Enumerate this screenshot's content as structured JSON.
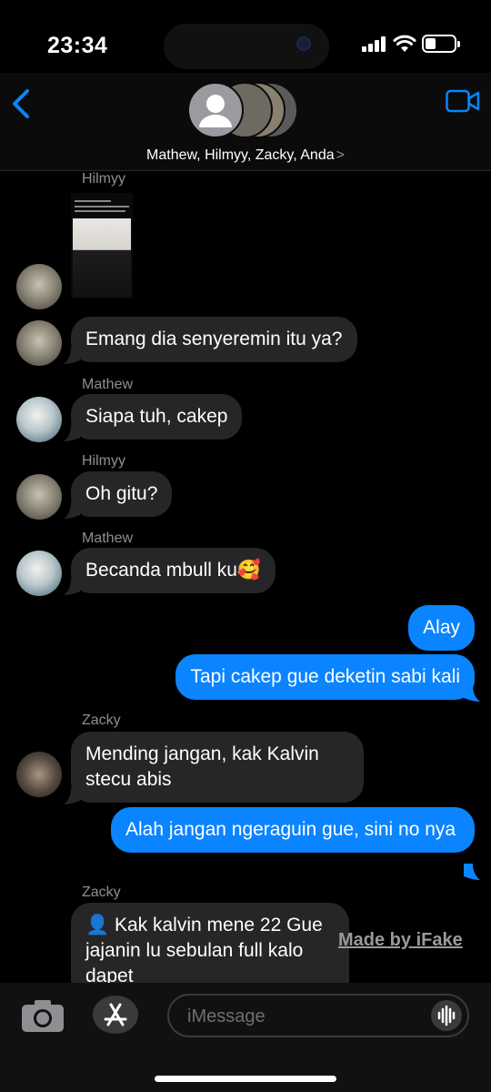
{
  "status_bar": {
    "time": "23:34",
    "battery_level": 0.35
  },
  "header": {
    "group_name": "Mathew, Hilmyy, Zacky, Anda",
    "chevron": ">"
  },
  "messages": [
    {
      "sender": "Hilmyy",
      "type": "image"
    },
    {
      "text": "Emang dia senyeremin itu ya?"
    },
    {
      "sender": "Mathew",
      "text": "Siapa tuh, cakep"
    },
    {
      "sender": "Hilmyy",
      "text": "Oh gitu?"
    },
    {
      "sender": "Mathew",
      "text": "Becanda mbull ku🥰"
    },
    {
      "text": "Alay"
    },
    {
      "text": "Tapi cakep gue deketin sabi kali"
    },
    {
      "sender": "Zacky",
      "text": "Mending jangan, kak Kalvin stecu abis"
    },
    {
      "text": "Alah jangan ngeraguin gue, sini no nya"
    },
    {
      "sender": "Zacky",
      "text": "👤 Kak kalvin mene 22 Gue jajanin lu sebulan full kalo dapet"
    }
  ],
  "watermark": "Made by iFake",
  "input": {
    "placeholder": "iMessage"
  },
  "colors": {
    "outgoing": "#0a84ff",
    "incoming": "#262628",
    "accent": "#0a84ff"
  }
}
